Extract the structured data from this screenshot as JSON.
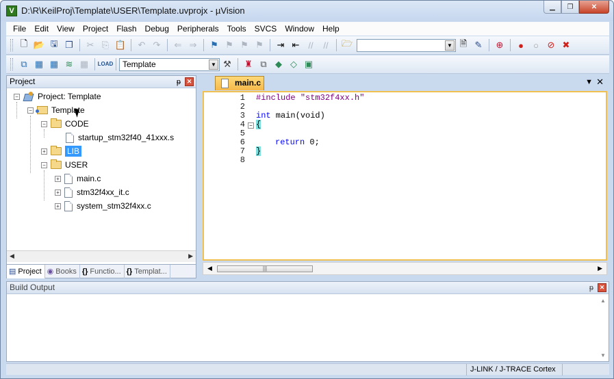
{
  "window": {
    "title": "D:\\R\\KeilProj\\Template\\USER\\Template.uvprojx - µVision",
    "minimize_glyph": "▁",
    "restore_glyph": "❐",
    "close_glyph": "✕"
  },
  "menubar": {
    "items": [
      "File",
      "Edit",
      "View",
      "Project",
      "Flash",
      "Debug",
      "Peripherals",
      "Tools",
      "SVCS",
      "Window",
      "Help"
    ]
  },
  "toolbar": {
    "search_value": "",
    "target_select": "Template",
    "load_label": "LOAD"
  },
  "project_panel": {
    "title": "Project",
    "pin_glyph": "ᵽ",
    "close_glyph": "✕",
    "root_label": "Project: Template",
    "target_label": "Template",
    "groups": {
      "code": "CODE",
      "lib": "LIB",
      "user": "USER"
    },
    "files": {
      "startup": "startup_stm32f40_41xxx.s",
      "main": "main.c",
      "it": "stm32f4xx_it.c",
      "system": "system_stm32f4xx.c"
    },
    "tabs": [
      {
        "label": "Project",
        "active": true
      },
      {
        "label": "Books",
        "active": false
      },
      {
        "label": "Functio...",
        "active": false
      },
      {
        "label": "Templat...",
        "active": false
      }
    ]
  },
  "editor": {
    "active_tab": "main.c",
    "line_numbers": [
      "1",
      "2",
      "3",
      "4",
      "5",
      "6",
      "7",
      "8"
    ],
    "code": {
      "l1_directive": "#include",
      "l1_header": "\"stm32f4xx.h\"",
      "l3_type": "int",
      "l3_rest": " main(void)",
      "l4": "{",
      "l6_kw": "return",
      "l6_rest": " 0;",
      "l7": "}"
    }
  },
  "build_output": {
    "title": "Build Output",
    "pin_glyph": "ᵽ",
    "close_glyph": "✕"
  },
  "statusbar": {
    "debugger": "J-LINK / J-TRACE Cortex"
  },
  "colors": {
    "frame": "#c9d9ee",
    "selection": "#3399ff",
    "tab_active": "#f5b94a",
    "keyword": "#0000ff",
    "string": "#800080"
  }
}
